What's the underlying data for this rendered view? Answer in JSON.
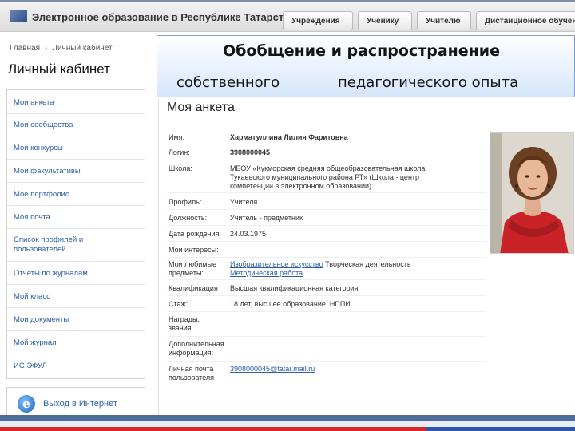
{
  "header": {
    "site_title": "Электронное образование в Республике Татарстан",
    "nav": [
      "Учреждения",
      "Ученику",
      "Учителю",
      "Дистанционное обучение"
    ]
  },
  "breadcrumb": [
    "Главная",
    "Личный кабинет"
  ],
  "page_title": "Личный кабинет",
  "sidebar": {
    "items": [
      "Мои анкета",
      "Мои сообщества",
      "Мои конкурсы",
      "Мои факультативы",
      "Мое портфолио",
      "Моя почта",
      "Список профилей и пользователей",
      "Отчеты по журналам",
      "Мой класс",
      "Мои документы",
      "Мой журнал",
      "ИС ЭФУЛ"
    ],
    "external_link": "Выход в Интернет"
  },
  "banner": {
    "line1": "Обобщение и распространение",
    "line2a": "собственного",
    "line2b": "педагогического опыта"
  },
  "profile": {
    "title": "Моя анкета",
    "fields": [
      {
        "label": "Имя:",
        "value": "Харматуллина Лилия Фаритовна"
      },
      {
        "label": "Логин:",
        "value": "3908000045"
      },
      {
        "label": "Школа:",
        "value": "МБОУ «Кукморская средняя общеобразовательная школа Тукаевского муниципального района РТ» (Школа - центр компетенции в электронном образовании)"
      },
      {
        "label": "Профиль:",
        "value": "Учителя"
      },
      {
        "label": "Должность:",
        "value": "Учитель - предметник"
      },
      {
        "label": "Дата рождения:",
        "value": "24.03.1975"
      },
      {
        "label": "Мои интересы:",
        "value": ""
      },
      {
        "label": "Мои любимые предметы:",
        "link1": "Изобразительное искусство",
        "value_rest": "Творческая деятельность",
        "link2": "Методическая работа"
      },
      {
        "label": "Квалификация",
        "value": "Высшая квалификационная категория"
      },
      {
        "label": "Стаж:",
        "value": "18 лет, высшее образование, НППИ"
      },
      {
        "label": "Награды, звания",
        "value": ""
      },
      {
        "label": "Дополнительная информация:",
        "value": ""
      },
      {
        "label": "Личная почта пользователя",
        "value": "3908000045@tatar.mail.ru"
      }
    ]
  },
  "colors": {
    "link": "#2b5fa6",
    "banner_border": "#7f9fcf",
    "bottom_strip": "#4d6c99",
    "accent_red": "#d7262b"
  }
}
